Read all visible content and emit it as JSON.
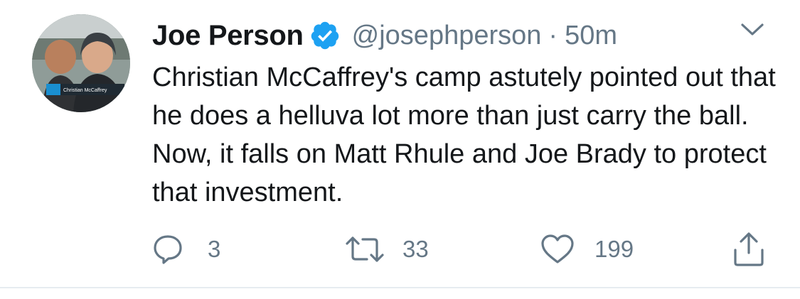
{
  "tweet": {
    "author": {
      "display_name": "Joe Person",
      "verified": true,
      "handle": "@josephperson",
      "separator": "·",
      "timestamp": "50m",
      "avatar_caption": "Christian McCaffrey"
    },
    "text": "Christian McCaffrey's camp astutely pointed out that he does a helluva lot more than just carry the ball. Now, it falls on Matt Rhule and Joe Brady to protect that investment.",
    "actions": {
      "reply": {
        "icon": "reply-icon",
        "count": "3"
      },
      "retweet": {
        "icon": "retweet-icon",
        "count": "33"
      },
      "like": {
        "icon": "heart-icon",
        "count": "199"
      },
      "share": {
        "icon": "share-icon"
      }
    }
  },
  "colors": {
    "text_primary": "#14171a",
    "text_secondary": "#657786",
    "verified_blue": "#1da1f2",
    "divider": "#e6ecf0"
  }
}
